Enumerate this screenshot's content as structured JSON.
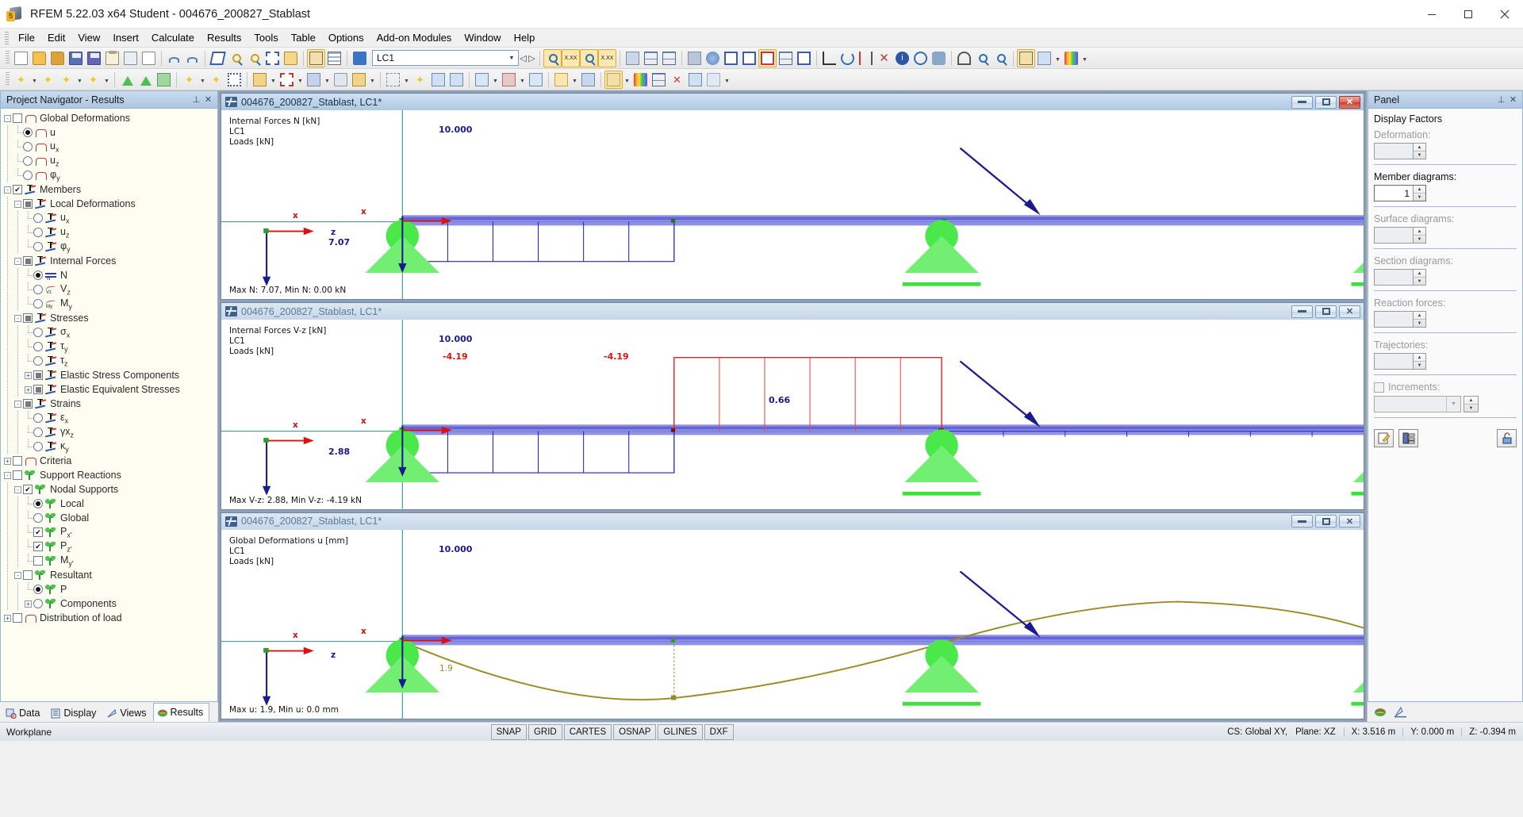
{
  "window": {
    "title": "RFEM 5.22.03 x64 Student - 004676_200827_Stablast",
    "minimize": "—",
    "maximize": "❐",
    "close": "✕"
  },
  "menu": {
    "items": [
      "File",
      "Edit",
      "View",
      "Insert",
      "Calculate",
      "Results",
      "Tools",
      "Table",
      "Options",
      "Add-on Modules",
      "Window",
      "Help"
    ]
  },
  "toolbar": {
    "load_case": "LC1",
    "load_case_dropdown": "▾",
    "icons_row1": [
      "new-document-icon",
      "open-folder-icon",
      "open-project-icon",
      "save-project-icon",
      "save-icon",
      "report-icon",
      "print-icon",
      "print-preview-icon",
      "undo-icon",
      "redo-icon",
      "edit-model-icon",
      "zoom-select-icon",
      "zoom-target-icon",
      "select-window-icon",
      "copy-icon",
      "printout-report-icon",
      "tables-icon",
      "load-case-icon"
    ],
    "icons_row1b": [
      "prev-lc-icon",
      "next-lc-icon",
      "results-on-icon",
      "values-on-icon",
      "results-surface-icon",
      "values-surface-icon",
      "render-icon",
      "nodes-on-icon",
      "wireframe-icon",
      "solid-icon",
      "render-model-icon",
      "grid-icon",
      "section-icon",
      "measure-icon",
      "rotate-icon",
      "mirror-icon",
      "cross-icon",
      "info-icon",
      "clock-icon",
      "gear-icon",
      "view-icon",
      "zoom-window-icon",
      "zoom-all-icon",
      "pan-icon",
      "view-3d-icon",
      "colors-icon",
      "palette-icon"
    ],
    "icons_row2": [
      "node-icon",
      "line-icon",
      "dim-line-icon",
      "polyline-icon",
      "support-icon",
      "member-support-icon",
      "surface-icon",
      "member-icon",
      "member-hinge-icon",
      "grid-region-icon",
      "solid-box-icon",
      "opening-icon",
      "extrude-icon",
      "solid-icon",
      "solid-set-icon",
      "result-beam-icon",
      "nodal-load-icon",
      "member-load-icon",
      "line-load-icon",
      "surface-load-icon",
      "free-load-icon",
      "imperfection-icon",
      "combination-icon",
      "calculate-icon",
      "results-icon",
      "legend-icon",
      "filter-icon",
      "clipping-icon"
    ]
  },
  "navigator": {
    "header": "Project Navigator - Results",
    "pin": "⊥",
    "close": "✕",
    "tree": [
      {
        "level": 0,
        "ctl": "checkbox",
        "state": "unchecked",
        "icon": "deformation-arch-icon",
        "label": "Global Deformations",
        "expander": "-"
      },
      {
        "level": 1,
        "ctl": "radio",
        "state": "selected",
        "icon": "deformation-arch-icon",
        "label": "u"
      },
      {
        "level": 1,
        "ctl": "radio",
        "state": "off",
        "icon": "deformation-arch-icon",
        "label": "ux"
      },
      {
        "level": 1,
        "ctl": "radio",
        "state": "off",
        "icon": "deformation-arch-icon",
        "label": "uz"
      },
      {
        "level": 1,
        "ctl": "radio",
        "state": "off",
        "icon": "deformation-arch-icon",
        "label": "φy"
      },
      {
        "level": 0,
        "ctl": "checkbox",
        "state": "checked",
        "icon": "member-axis-icon",
        "label": "Members",
        "expander": "-"
      },
      {
        "level": 1,
        "ctl": "checkbox",
        "state": "partial",
        "icon": "member-axis-icon",
        "label": "Local Deformations",
        "expander": "-"
      },
      {
        "level": 2,
        "ctl": "radio",
        "state": "off",
        "icon": "member-axis-icon",
        "label": "ux"
      },
      {
        "level": 2,
        "ctl": "radio",
        "state": "off",
        "icon": "member-axis-icon",
        "label": "uz"
      },
      {
        "level": 2,
        "ctl": "radio",
        "state": "off",
        "icon": "member-axis-icon",
        "label": "φy"
      },
      {
        "level": 1,
        "ctl": "checkbox",
        "state": "partial",
        "icon": "member-axis-icon",
        "label": "Internal Forces",
        "expander": "-"
      },
      {
        "level": 2,
        "ctl": "radio",
        "state": "selected",
        "icon": "axial-force-icon",
        "label": "N"
      },
      {
        "level": 2,
        "ctl": "radio",
        "state": "off",
        "icon": "shear-force-icon",
        "label": "Vz"
      },
      {
        "level": 2,
        "ctl": "radio",
        "state": "off",
        "icon": "moment-icon",
        "label": "My"
      },
      {
        "level": 1,
        "ctl": "checkbox",
        "state": "partial",
        "icon": "member-axis-icon",
        "label": "Stresses",
        "expander": "-"
      },
      {
        "level": 2,
        "ctl": "radio",
        "state": "off",
        "icon": "member-axis-icon",
        "label": "σx"
      },
      {
        "level": 2,
        "ctl": "radio",
        "state": "off",
        "icon": "member-axis-icon",
        "label": "τy"
      },
      {
        "level": 2,
        "ctl": "radio",
        "state": "off",
        "icon": "member-axis-icon",
        "label": "τz"
      },
      {
        "level": 2,
        "ctl": "checkbox",
        "state": "partial",
        "icon": "member-axis-icon",
        "label": "Elastic Stress Components",
        "expander": "+"
      },
      {
        "level": 2,
        "ctl": "checkbox",
        "state": "partial",
        "icon": "member-axis-icon",
        "label": "Elastic Equivalent Stresses",
        "expander": "+"
      },
      {
        "level": 1,
        "ctl": "checkbox",
        "state": "partial",
        "icon": "member-axis-icon",
        "label": "Strains",
        "expander": "-"
      },
      {
        "level": 2,
        "ctl": "radio",
        "state": "off",
        "icon": "member-axis-icon",
        "label": "εx"
      },
      {
        "level": 2,
        "ctl": "radio",
        "state": "off",
        "icon": "member-axis-icon",
        "label": "γxz"
      },
      {
        "level": 2,
        "ctl": "radio",
        "state": "off",
        "icon": "member-axis-icon",
        "label": "κy"
      },
      {
        "level": 0,
        "ctl": "checkbox",
        "state": "unchecked",
        "icon": "deformation-arch-icon",
        "label": "Criteria",
        "expander": "+"
      },
      {
        "level": 0,
        "ctl": "checkbox",
        "state": "unchecked",
        "icon": "support-icon",
        "label": "Support Reactions",
        "expander": "-"
      },
      {
        "level": 1,
        "ctl": "checkbox",
        "state": "checked",
        "icon": "support-icon",
        "label": "Nodal Supports",
        "expander": "-"
      },
      {
        "level": 2,
        "ctl": "radio",
        "state": "selected",
        "icon": "support-icon",
        "label": "Local"
      },
      {
        "level": 2,
        "ctl": "radio",
        "state": "off",
        "icon": "support-icon",
        "label": "Global"
      },
      {
        "level": 2,
        "ctl": "checkbox",
        "state": "checked",
        "icon": "support-icon",
        "label": "Px'"
      },
      {
        "level": 2,
        "ctl": "checkbox",
        "state": "checked",
        "icon": "support-icon",
        "label": "Pz'"
      },
      {
        "level": 2,
        "ctl": "checkbox",
        "state": "unchecked",
        "icon": "support-icon",
        "label": "My'"
      },
      {
        "level": 1,
        "ctl": "checkbox",
        "state": "unchecked",
        "icon": "support-icon",
        "label": "Resultant",
        "expander": "-"
      },
      {
        "level": 2,
        "ctl": "radio",
        "state": "selected",
        "icon": "support-icon",
        "label": "P"
      },
      {
        "level": 2,
        "ctl": "radio",
        "state": "off",
        "icon": "support-icon",
        "label": "Components",
        "expander": "+"
      },
      {
        "level": 0,
        "ctl": "checkbox",
        "state": "unchecked",
        "icon": "deformation-arch-icon",
        "label": "Distribution of load",
        "expander": "+"
      }
    ],
    "tabs": [
      {
        "label": "Data",
        "icon": "data-icon",
        "active": false
      },
      {
        "label": "Display",
        "icon": "display-icon",
        "active": false
      },
      {
        "label": "Views",
        "icon": "views-icon",
        "active": false
      },
      {
        "label": "Results",
        "icon": "results-icon",
        "active": true
      }
    ]
  },
  "viewports": [
    {
      "title": "004676_200827_Stablast, LC1*",
      "active": true,
      "legend": [
        "Internal Forces N [kN]",
        "LC1",
        "Loads [kN]"
      ],
      "load_label": "10.000",
      "support_value": "7.07",
      "status": "Max N: 7.07, Min N: 0.00 kN",
      "axis_x": "x",
      "axis_z": "z"
    },
    {
      "title": "004676_200827_Stablast, LC1*",
      "active": false,
      "legend": [
        "Internal Forces V-z [kN]",
        "LC1",
        "Loads [kN]"
      ],
      "load_label": "10.000",
      "support_value": "2.88",
      "diagram_left": "-4.19",
      "diagram_right": "-4.19",
      "diagram_tail": "0.66",
      "status": "Max V-z: 2.88, Min V-z: -4.19 kN",
      "axis_x": "x",
      "axis_z": "z"
    },
    {
      "title": "004676_200827_Stablast, LC1*",
      "active": false,
      "legend": [
        "Global Deformations u [mm]",
        "LC1",
        "Loads [kN]"
      ],
      "load_label": "10.000",
      "deflection_value": "1.9",
      "status": "Max u: 1.9, Min u: 0.0 mm",
      "axis_x": "x",
      "axis_z": "z"
    }
  ],
  "panel": {
    "header": "Panel",
    "pin": "⊥",
    "close": "✕",
    "section_title": "Display Factors",
    "groups": [
      {
        "label": "Deformation:",
        "value": "",
        "enabled": false
      },
      {
        "label": "Member diagrams:",
        "value": "1",
        "enabled": true
      },
      {
        "label": "Surface diagrams:",
        "value": "",
        "enabled": false
      },
      {
        "label": "Section diagrams:",
        "value": "",
        "enabled": false
      },
      {
        "label": "Reaction forces:",
        "value": "",
        "enabled": false
      },
      {
        "label": "Trajectories:",
        "value": "",
        "enabled": false
      }
    ],
    "increments_label": "Increments:",
    "increments_value": "",
    "buttons": [
      "edit-panel-icon",
      "colors-panel-icon",
      "lock-panel-icon"
    ],
    "tabs": [
      "panel-colors-icon",
      "panel-factors-icon"
    ]
  },
  "statusbar": {
    "workplane": "Workplane",
    "toggles": [
      "SNAP",
      "GRID",
      "CARTES",
      "OSNAP",
      "GLINES",
      "DXF"
    ],
    "cs": "CS: Global XY,",
    "plane": "Plane: XZ",
    "x": "X:  3.516 m",
    "y": "Y:  0.000 m",
    "z": "Z:  -0.394 m"
  },
  "colors": {
    "member_blue": "#7c7ce0",
    "support_green": "#5ef05e",
    "diagram_red": "#ee2222",
    "diagram_blue": "#2222cc",
    "deflection_olive": "#9a8b22",
    "axis_teal": "#2e8f8f",
    "load_arrow": "#1a1a8c"
  }
}
